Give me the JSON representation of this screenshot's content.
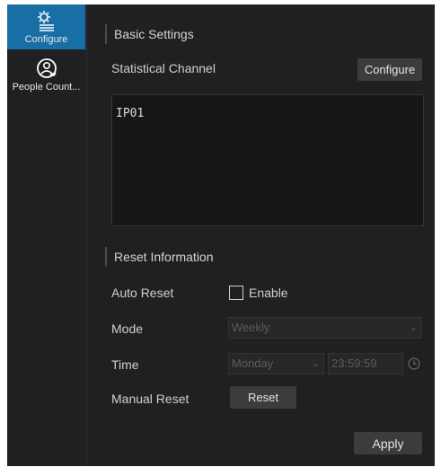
{
  "sidebar": {
    "items": [
      {
        "label": "Configure",
        "icon": "settings-list-icon",
        "active": true
      },
      {
        "label": "People Count...",
        "icon": "people-count-icon",
        "active": false
      }
    ]
  },
  "basic_settings": {
    "title": "Basic Settings",
    "statistical_channel_label": "Statistical Channel",
    "configure_button": "Configure",
    "channels": [
      "IP01"
    ]
  },
  "reset_information": {
    "title": "Reset Information",
    "auto_reset_label": "Auto Reset",
    "enable_label": "Enable",
    "enable_checked": false,
    "mode_label": "Mode",
    "mode_value": "Weekly",
    "time_label": "Time",
    "day_value": "Monday",
    "time_value": "23:59:59",
    "manual_reset_label": "Manual Reset",
    "reset_button": "Reset"
  },
  "footer": {
    "apply_button": "Apply"
  },
  "colors": {
    "accent": "#176fa6",
    "background": "#1f2021",
    "panel": "#151617"
  }
}
